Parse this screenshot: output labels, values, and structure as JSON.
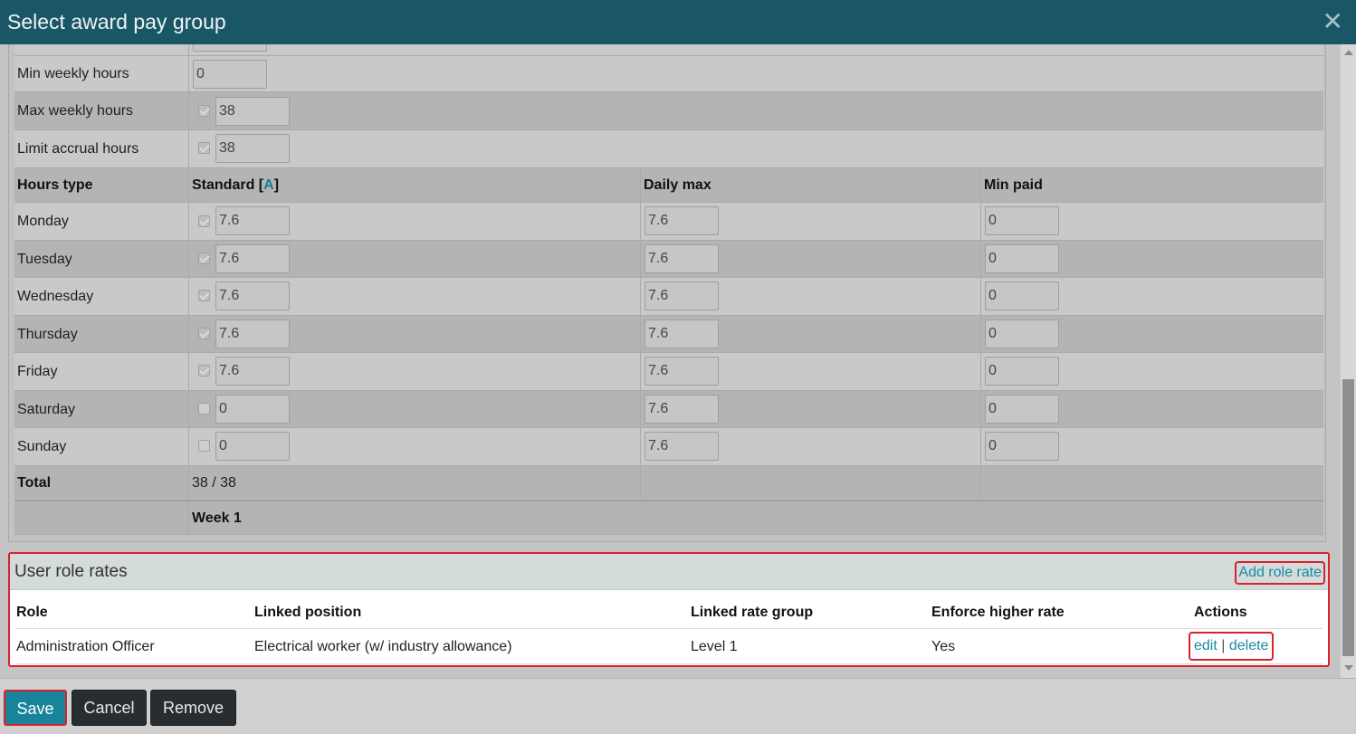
{
  "dialog": {
    "title": "Select award pay group",
    "close_glyph": "✕"
  },
  "settings": {
    "min_weekly_hours": {
      "label": "Min weekly hours",
      "value": "0"
    },
    "max_weekly_hours": {
      "label": "Max weekly hours",
      "value": "38",
      "checked": true
    },
    "limit_accrual_hours": {
      "label": "Limit accrual hours",
      "value": "38",
      "checked": true
    }
  },
  "hours_table": {
    "headers": {
      "hours_type": "Hours type",
      "standard_prefix": "Standard [",
      "standard_link": "A",
      "standard_suffix": "]",
      "daily_max": "Daily max",
      "min_paid": "Min paid"
    },
    "days": [
      {
        "day": "Monday",
        "checked": true,
        "standard": "7.6",
        "daily_max": "7.6",
        "min_paid": "0"
      },
      {
        "day": "Tuesday",
        "checked": true,
        "standard": "7.6",
        "daily_max": "7.6",
        "min_paid": "0"
      },
      {
        "day": "Wednesday",
        "checked": true,
        "standard": "7.6",
        "daily_max": "7.6",
        "min_paid": "0"
      },
      {
        "day": "Thursday",
        "checked": true,
        "standard": "7.6",
        "daily_max": "7.6",
        "min_paid": "0"
      },
      {
        "day": "Friday",
        "checked": true,
        "standard": "7.6",
        "daily_max": "7.6",
        "min_paid": "0"
      },
      {
        "day": "Saturday",
        "checked": false,
        "standard": "0",
        "daily_max": "7.6",
        "min_paid": "0"
      },
      {
        "day": "Sunday",
        "checked": false,
        "standard": "0",
        "daily_max": "7.6",
        "min_paid": "0"
      }
    ],
    "total_label": "Total",
    "total_value": "38 / 38",
    "week_label": "Week 1"
  },
  "user_role_rates": {
    "title": "User role rates",
    "add_label": "Add role rate",
    "columns": [
      "Role",
      "Linked position",
      "Linked rate group",
      "Enforce higher rate",
      "Actions"
    ],
    "rows": [
      {
        "role": "Administration Officer",
        "linked_position": "Electrical worker (w/ industry allowance)",
        "linked_rate_group": "Level 1",
        "enforce_higher_rate": "Yes",
        "edit_label": "edit",
        "separator": "|",
        "delete_label": "delete"
      }
    ]
  },
  "footer": {
    "save_label": "Save",
    "cancel_label": "Cancel",
    "remove_label": "Remove"
  },
  "colors": {
    "titlebar": "#1a5766",
    "accent": "#18839a",
    "highlight": "#d9232b"
  }
}
